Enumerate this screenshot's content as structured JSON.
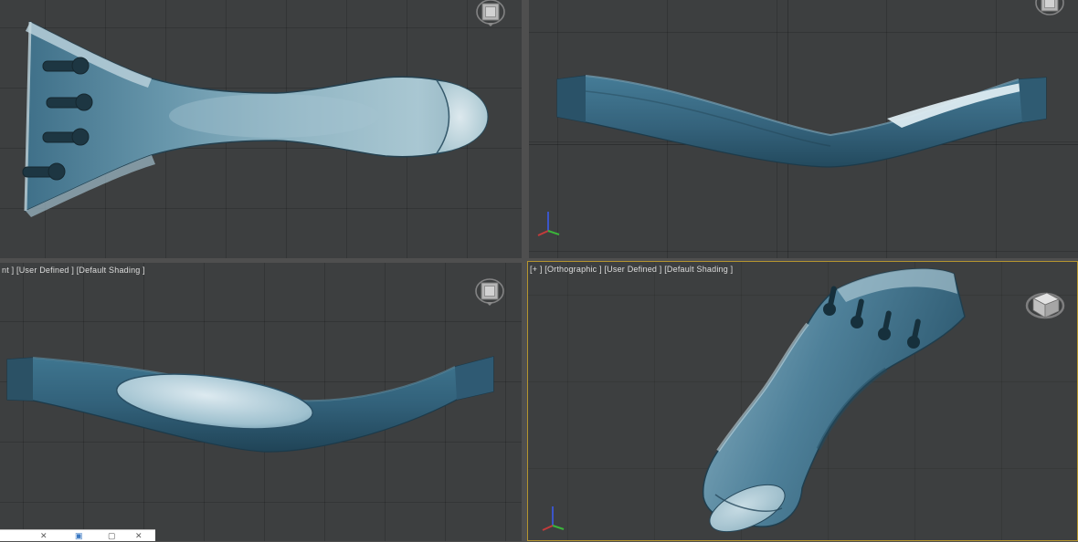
{
  "viewport_labels": {
    "bottom_left": "nt ] [User Defined ] [Default Shading ]",
    "bottom_right": "[+ ] [Orthographic ] [User Defined ] [Default Shading ]"
  },
  "model": {
    "description": "teal tailpiece 3D model shown in four views"
  },
  "background_window": {
    "icons": [
      {
        "name": "close",
        "glyph": "✕"
      },
      {
        "name": "app",
        "glyph": "▣"
      },
      {
        "name": "maximize",
        "glyph": "▢"
      },
      {
        "name": "close",
        "glyph": "✕"
      }
    ]
  },
  "colors": {
    "viewport_background": "#3d3f40",
    "grid_line": "#343638",
    "viewport_divider": "#4f4f4f",
    "active_viewport_border": "#b5952f",
    "model_teal": "#4a7f99",
    "model_teal_dark": "#2b5268",
    "model_highlight": "#dcebf1",
    "axis_x": "#c23b3b",
    "axis_y": "#3bb43b",
    "axis_z": "#3b55c8"
  }
}
